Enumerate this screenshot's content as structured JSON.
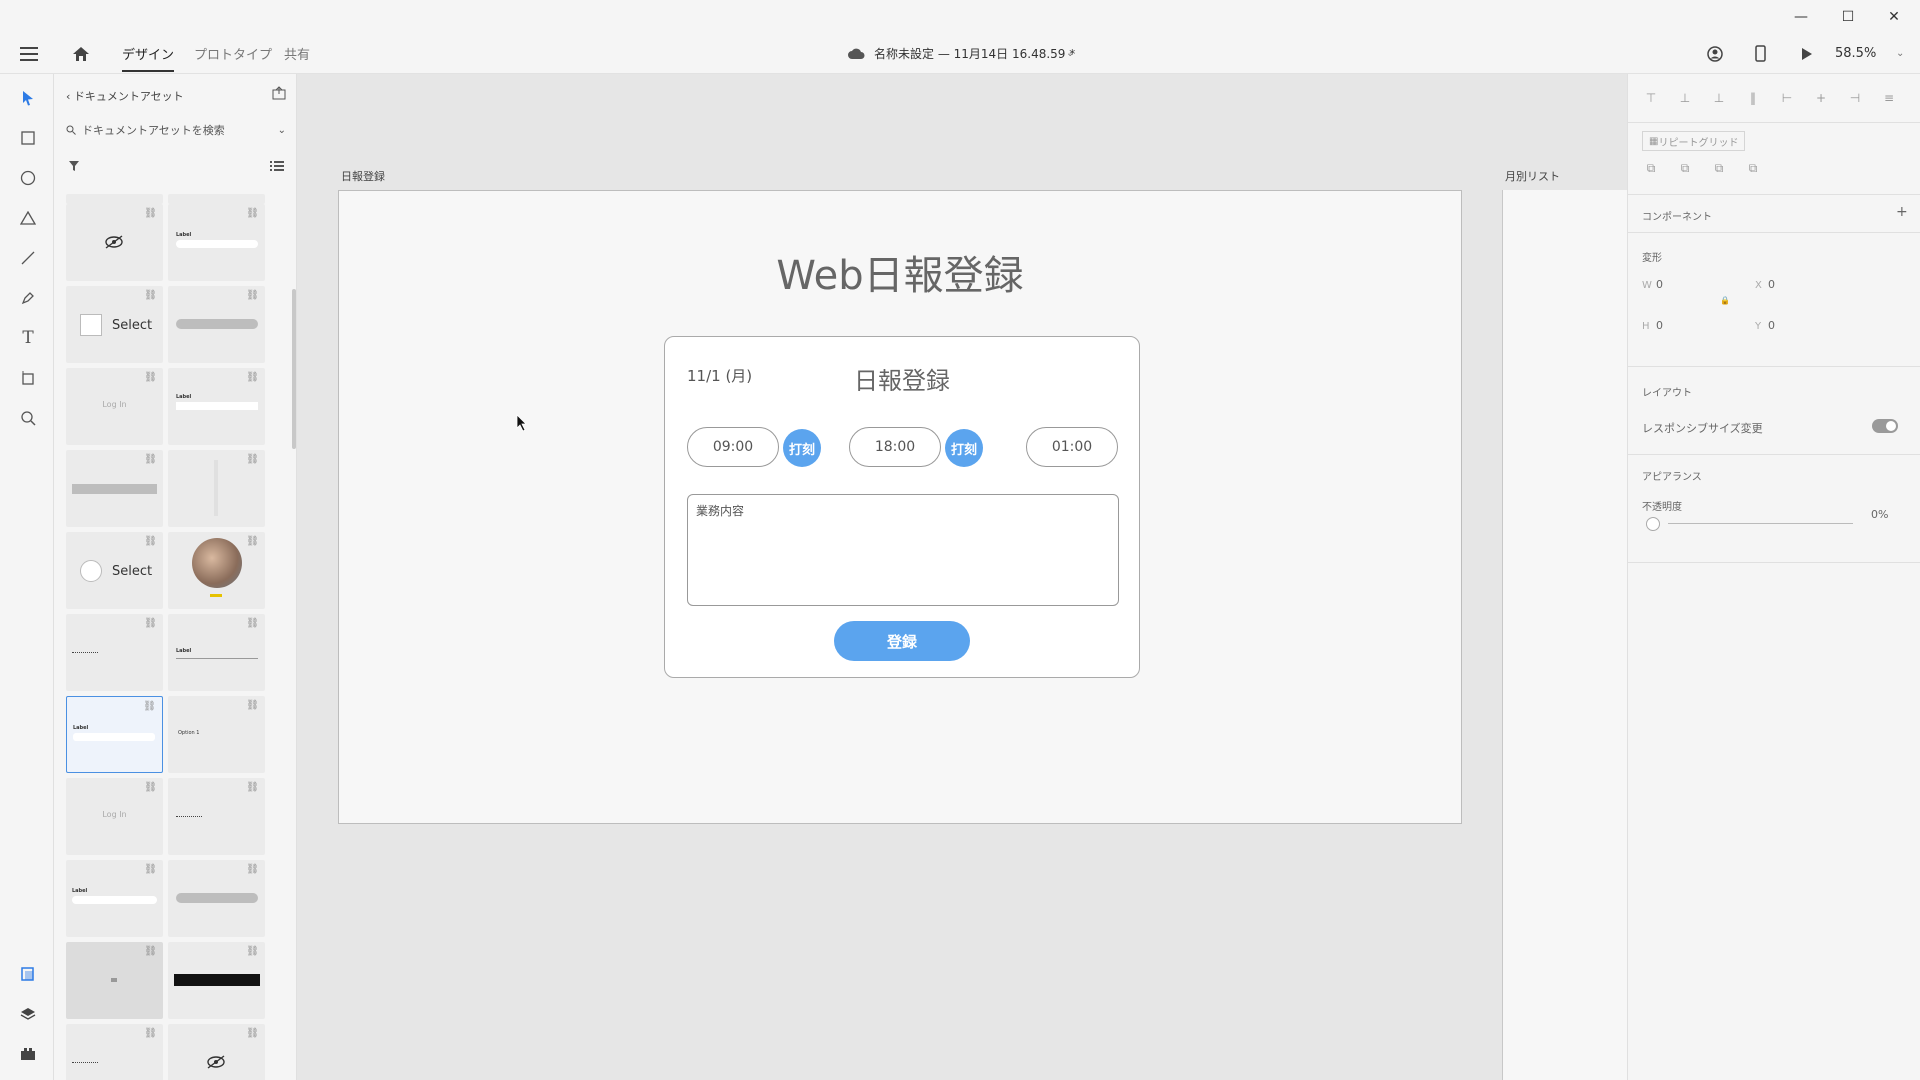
{
  "titlebar": {
    "minimize": "—",
    "maximize": "☐",
    "close": "✕"
  },
  "appbar": {
    "tabs": [
      {
        "label": "デザイン"
      },
      {
        "label": "プロトタイプ"
      },
      {
        "label": "共有"
      }
    ],
    "document_title": "名称未設定 — 11月14日 16.48.59 *",
    "zoom": "58.5%"
  },
  "assets": {
    "back_label": "ドキュメントアセット",
    "search_placeholder": "ドキュメントアセットを検索",
    "thumbs": [
      {
        "text": ""
      },
      {
        "text": "Label"
      },
      {
        "text": "Select"
      },
      {
        "text": ""
      },
      {
        "text": "Log In"
      },
      {
        "text": "Label"
      },
      {
        "text": ""
      },
      {
        "text": ""
      },
      {
        "text": "Select"
      },
      {
        "text": ""
      },
      {
        "text": ""
      },
      {
        "text": "Label"
      },
      {
        "text": "Label"
      },
      {
        "text": "Option 1"
      },
      {
        "text": "Log In"
      },
      {
        "text": ""
      },
      {
        "text": "Label"
      },
      {
        "text": ""
      },
      {
        "text": ""
      },
      {
        "text": ""
      },
      {
        "text": ""
      },
      {
        "text": ""
      }
    ]
  },
  "canvas": {
    "artboard1_label": "日報登録",
    "artboard2_label": "月別リスト",
    "page_title": "Web日報登録",
    "card": {
      "date": "11/1 (月)",
      "title": "日報登録",
      "start_time": "09:00",
      "end_time": "18:00",
      "break_time": "01:00",
      "stamp_label": "打刻",
      "textarea_placeholder": "業務内容",
      "submit_label": "登録"
    }
  },
  "props": {
    "repeat_grid": "リピートグリッド",
    "component": "コンポーネント",
    "transform": "変形",
    "w_label": "W",
    "w_value": "0",
    "x_label": "X",
    "x_value": "0",
    "h_label": "H",
    "h_value": "0",
    "y_label": "Y",
    "y_value": "0",
    "layout": "レイアウト",
    "responsive_resize": "レスポンシブサイズ変更",
    "appearance": "アピアランス",
    "opacity_label": "不透明度",
    "opacity_value": "0%"
  },
  "colors": {
    "accent": "#5ba4ee",
    "selection": "#4a90e2"
  }
}
